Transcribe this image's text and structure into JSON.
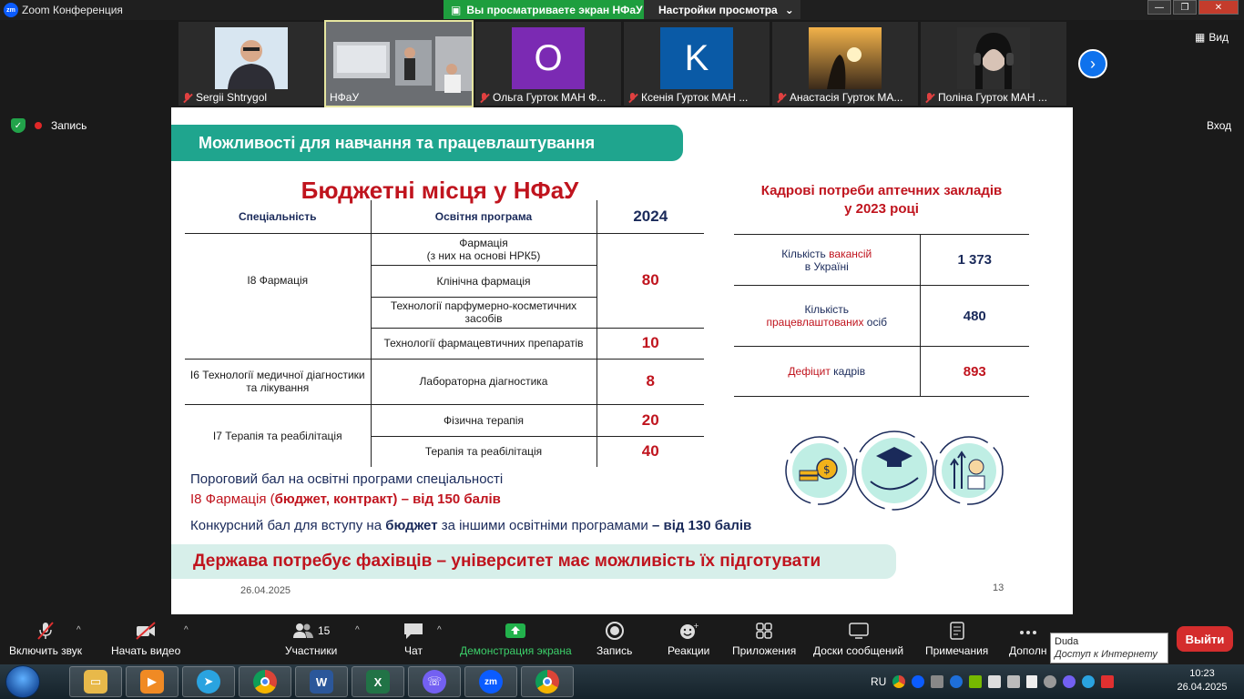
{
  "window": {
    "title": "Zoom Конференция",
    "share_banner": "Вы просматриваете экран НФаУ",
    "view_settings": "Настройки просмотра"
  },
  "participants_strip": [
    {
      "name": "Sergii Shtrygol",
      "muted": true,
      "type": "photo"
    },
    {
      "name": "НФаУ",
      "muted": false,
      "type": "video"
    },
    {
      "name": "Ольга Гурток МАН Ф...",
      "muted": true,
      "type": "letter",
      "letter": "О",
      "color": "#7b2ab3"
    },
    {
      "name": "Ксенія Гурток МАН ...",
      "muted": true,
      "type": "letter",
      "letter": "K",
      "color": "#0a5aa6"
    },
    {
      "name": "Анастасія Гурток МА...",
      "muted": true,
      "type": "sunset"
    },
    {
      "name": "Поліна Гурток МАН ...",
      "muted": true,
      "type": "portrait"
    }
  ],
  "view_label": "Вид",
  "recording_label": "Запись",
  "enter_label": "Вход",
  "slide": {
    "header": "Можливості для навчання та працевлаштування",
    "budget_title": "Бюджетні місця у НФаУ",
    "table_headers": {
      "specialty": "Спеціальність",
      "program": "Освітня програма",
      "year": "2024"
    },
    "rows": {
      "i8": "I8 Фармація",
      "i8_prog1": "Фармація\n(з них на основі НРК5)",
      "i8_prog2": "Клінічна фармація",
      "i8_prog3": "Технології парфумерно-косметичних засобів",
      "i8_num_a": "80",
      "i8_prog4": "Технології фармацевтичних препаратів",
      "i8_num_b": "10",
      "i6": "I6 Технології медичної діагностики та лікування",
      "i6_prog": "Лабораторна діагностика",
      "i6_num": "8",
      "i7": "I7 Терапія та реабілітація",
      "i7_prog1": "Фізична терапія",
      "i7_num1": "20",
      "i7_prog2": "Терапія та реабілітація",
      "i7_num2": "40"
    },
    "needs_title_line1": "Кадрові потреби аптечних закладів",
    "needs_title_line2": "у 2023 році",
    "needs": {
      "vac_a": "Кількість ",
      "vac_b": "вакансій",
      "vac_c": "в Україні",
      "vac_val": "1 373",
      "emp_a": "Кількість",
      "emp_b": "працевлаштованих",
      "emp_c": " осіб",
      "emp_val": "480",
      "def_a": "Дефіцит",
      "def_b": " кадрів",
      "def_val": "893"
    },
    "note1_line1": "Пороговий бал на освітні програми спеціальності",
    "note1_a": "I8 Фармація (",
    "note1_b": "бюджет, контракт) – від 150 балів",
    "note2_a": "Конкурсний бал для вступу на ",
    "note2_b": "бюджет",
    "note2_c": " за іншими освітніми програмами ",
    "note2_d": "– від 130 балів",
    "bottom_band": "Держава потребує фахівців – університет має можливість їх підготувати",
    "date": "26.04.2025",
    "page": "13"
  },
  "toolbar": {
    "audio": "Включить звук",
    "video": "Начать видео",
    "participants": "Участники",
    "participants_count": "15",
    "chat": "Чат",
    "share": "Демонстрация экрана",
    "record": "Запись",
    "reactions": "Реакции",
    "apps": "Приложения",
    "whiteboards": "Доски сообщений",
    "notes": "Примечания",
    "more": "Дополн",
    "leave": "Выйти"
  },
  "tooltip": {
    "title": "Duda",
    "subtitle": "Доступ к Интернету"
  },
  "taskbar": {
    "lang": "RU",
    "time": "10:23",
    "date": "26.04.2025"
  }
}
